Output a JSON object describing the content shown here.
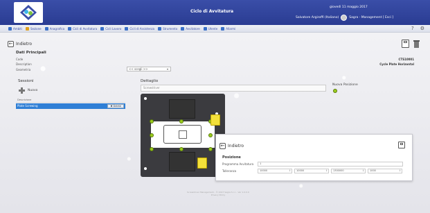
{
  "header": {
    "title": "Ciclo di Avvitatura",
    "date": "giovedì 11 maggio 2017",
    "user": "Salvatore Argiroffi (Italiano)",
    "role": "Sagra - Management [ Esci ]"
  },
  "menu": {
    "items": [
      {
        "label": "Ambiti",
        "icon": "ambiti-icon",
        "color": "#3a70c8"
      },
      {
        "label": "Sezione",
        "icon": "sezione-icon",
        "color": "#e0a020"
      },
      {
        "label": "Anagrafica",
        "icon": "anagrafica-icon",
        "color": "#3a70c8"
      },
      {
        "label": "Cicli di Avvitatura",
        "icon": "cicli-avvitatura-icon",
        "color": "#3a70c8"
      },
      {
        "label": "Cicli Lavoro",
        "icon": "cicli-lavoro-icon",
        "color": "#3a70c8"
      },
      {
        "label": "Cicli di Assistenza",
        "icon": "cicli-assistenza-icon",
        "color": "#3a70c8"
      },
      {
        "label": "Strumento",
        "icon": "strumento-icon",
        "color": "#3a70c8"
      },
      {
        "label": "Avvitatore",
        "icon": "avvitatore-icon",
        "color": "#3a70c8"
      },
      {
        "label": "Utente",
        "icon": "utente-icon",
        "color": "#3a70c8"
      },
      {
        "label": "Allarmi",
        "icon": "allarmi-icon",
        "color": "#3a70c8"
      }
    ],
    "help": "?",
    "settings": "⚙"
  },
  "page": {
    "back_label": "Indietro",
    "section_title": "Dati Principali",
    "code_label": "Code",
    "code_value": "CTS10001",
    "description_label": "Description",
    "description_value": "Cycle Plate Horizontal",
    "geometry_label": "Geometria",
    "geometry_select": "<< scegli >>"
  },
  "sessions": {
    "title": "Sessioni",
    "new_label": "Nuovo",
    "column_header": "Descrizione",
    "rows": [
      {
        "label": "Plate Screwing",
        "delete_label": "Delete"
      }
    ]
  },
  "detail": {
    "title": "Dettaglio",
    "name_placeholder": "Screwdriver",
    "new_position_label": "Nuova Posizione"
  },
  "popup": {
    "back_label": "Indietro",
    "position_title": "Posizione",
    "program_label": "Programma Avvitatura",
    "program_value": "1",
    "tolerance_label": "Tolleranza",
    "tol_values": [
      "10000",
      "10000",
      "1300000",
      "1000"
    ]
  },
  "footer": {
    "line1": "Screwdriver Management - © 2017 Sagra S.r.l. - Ver 1.0.0.0",
    "line2": "Privacy Policy"
  },
  "colors": {
    "header": "#2f429c",
    "selected_row": "#2f7fd6",
    "position_dot": "#9acc1e",
    "piece": "#f3e03a"
  }
}
